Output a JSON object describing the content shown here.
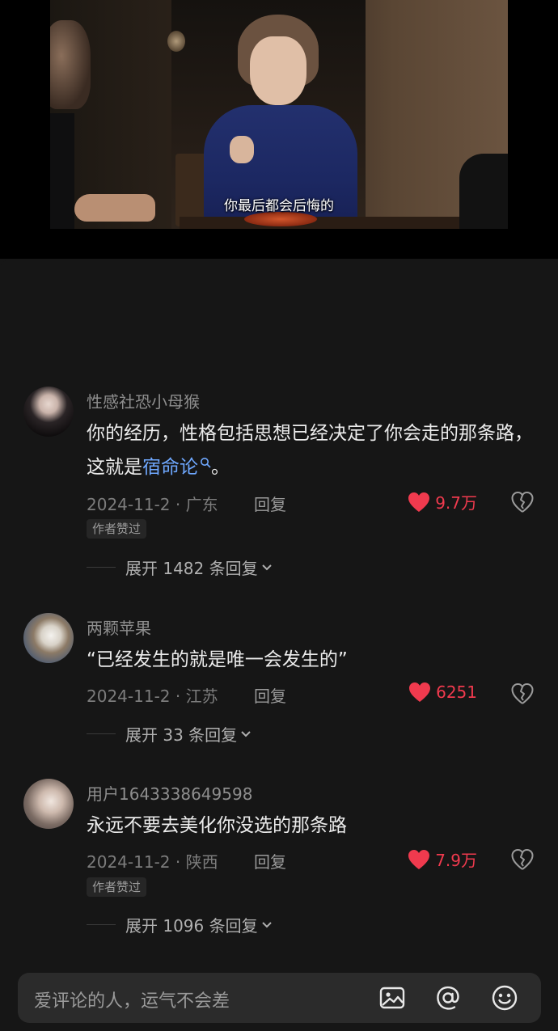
{
  "video": {
    "subtitle": "你最后都会后悔的"
  },
  "comments": [
    {
      "nickname": "性感社恐小母猴",
      "content_before": "你的经历，性格包括思想已经决定了你会走的那条路，这就是",
      "content_link": "宿命论",
      "content_after": "。",
      "meta": "2024-11-2 · 广东",
      "reply_label": "回复",
      "likes": "9.7万",
      "author_tag": "作者赞过",
      "expand_label": "展开 1482 条回复"
    },
    {
      "nickname": "两颗苹果",
      "content": "“已经发生的就是唯一会发生的”",
      "meta": "2024-11-2 · 江苏",
      "reply_label": "回复",
      "likes": "6251",
      "expand_label": "展开 33 条回复"
    },
    {
      "nickname": "用户1643338649598",
      "content": "永远不要去美化你没选的那条路",
      "meta": "2024-11-2 · 陕西",
      "reply_label": "回复",
      "likes": "7.9万",
      "author_tag": "作者赞过",
      "expand_label": "展开 1096 条回复"
    }
  ],
  "input_bar": {
    "placeholder": "爱评论的人，运气不会差",
    "icons": [
      "image-icon",
      "at-icon",
      "emoji-icon"
    ]
  },
  "colors": {
    "background": "#161616",
    "like_red": "#f03a4e",
    "link_blue": "#6fa8ff"
  }
}
